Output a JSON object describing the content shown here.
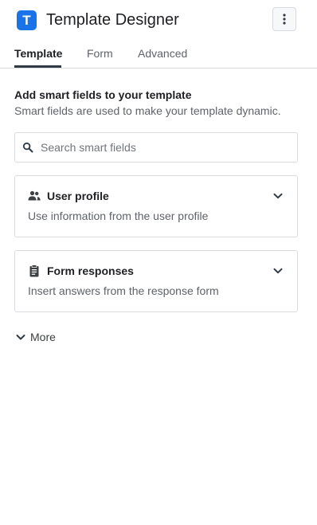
{
  "header": {
    "logo_letter": "T",
    "title": "Template Designer",
    "menu_icon": "more-vertical-icon"
  },
  "tabs": [
    {
      "label": "Template",
      "active": true
    },
    {
      "label": "Form",
      "active": false
    },
    {
      "label": "Advanced",
      "active": false
    }
  ],
  "smart_fields": {
    "heading": "Add smart fields to your template",
    "subheading": "Smart fields are used to make your template dynamic.",
    "search": {
      "placeholder": "Search smart fields",
      "value": "",
      "icon": "search-icon"
    },
    "groups": [
      {
        "title": "User profile",
        "description": "Use information from the user profile",
        "icon": "users-icon",
        "expanded": false
      },
      {
        "title": "Form responses",
        "description": "Insert answers from the response form",
        "icon": "clipboard-icon",
        "expanded": false
      }
    ],
    "more_label": "More"
  },
  "colors": {
    "brand": "#1a73e8",
    "text_primary": "#202124",
    "text_secondary": "#5f6368",
    "border": "#dadce0",
    "tab_underline": "#2f3a45"
  }
}
